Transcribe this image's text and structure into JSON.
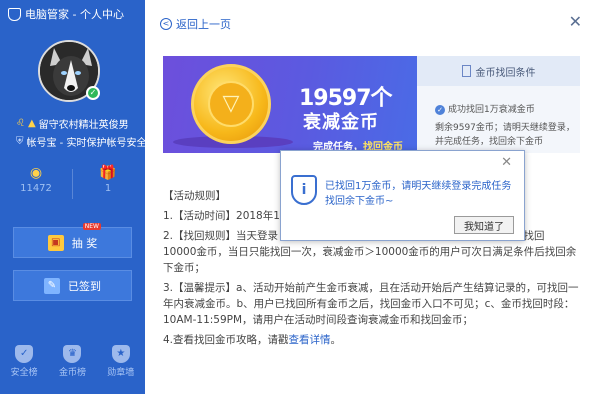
{
  "app": {
    "title": "电脑管家 - 个人中心"
  },
  "sidebar": {
    "badge_line": "留守农村精壮英俊男",
    "account_line": "帐号宝 - 实时保护帐号安全",
    "stats": [
      {
        "value": "11472",
        "icon": "gold-coin-icon"
      },
      {
        "value": "1",
        "icon": "gift-icon"
      }
    ],
    "lottery_label": "抽 奖",
    "lottery_tag": "NEW",
    "signed_label": "已签到",
    "bottom": [
      {
        "label": "安全榜",
        "icon": "shield-check-icon"
      },
      {
        "label": "金币榜",
        "icon": "crown-icon"
      },
      {
        "label": "勋章墙",
        "icon": "medal-icon"
      }
    ]
  },
  "main": {
    "back_label": "返回上一页",
    "banner": {
      "number": "19597个",
      "text": "衰减金币",
      "task_prefix": "完成任务，",
      "task_highlight": "找回金币"
    },
    "conditions": {
      "title": "金币找回条件",
      "item1": "成功找回1万衰减金币",
      "item2_line1": "剩余9597金币；请明天继续登录，",
      "item2_line2": "并完成任务，找回余下金币"
    },
    "rules": {
      "heading": "【活动规则】",
      "r1": "1.【活动时间】2018年1/",
      "r2": "2.【找回规则】当天登录",
      "r2b": "日最多找回",
      "r2c": "10000金币，当日只能找回一次，衰减金币＞10000金币的用户可次日满足条件后找回余下金币；",
      "r3": "3.【温馨提示】a、活动开始前产生金币衰减，且在活动开始后产生结算记录的，可找回一年内衰减金币。b、用户已找回所有金币之后，找回金币入口不可见；c、金币找回时段：10AM-11:59PM，请用户在活动时间段查询衰减金币和找回金币；",
      "r4_prefix": "4.查看找回金币攻略，请戳",
      "r4_link": "查看详情",
      "r4_suffix": "。"
    }
  },
  "dialog": {
    "message": "已找回1万金币，请明天继续登录完成任务找回余下金币~",
    "ok_label": "我知道了"
  },
  "colors": {
    "sidebar": "#2a63c9",
    "accent": "#2a63c9"
  }
}
